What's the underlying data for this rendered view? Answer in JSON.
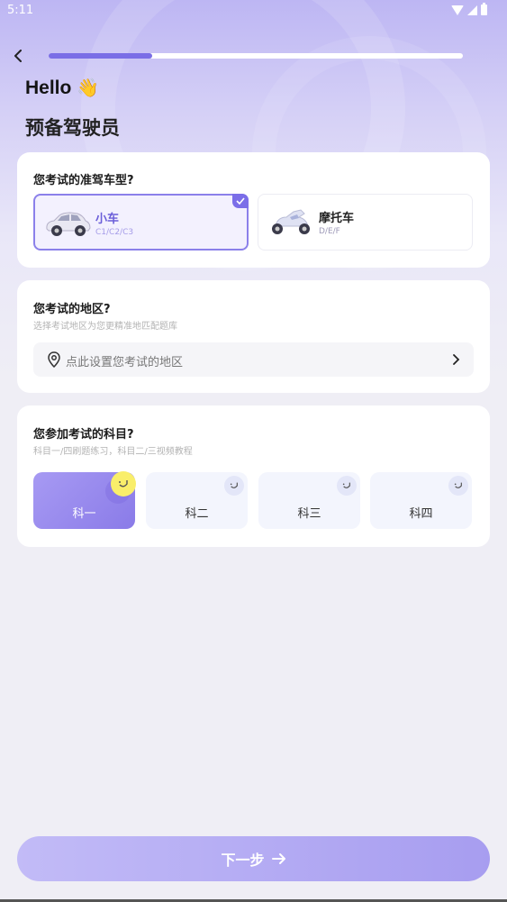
{
  "status": {
    "time": "5:11"
  },
  "header": {
    "progress": 0.25,
    "greeting": "Hello",
    "emoji": "👋",
    "subtitle": "预备驾驶员"
  },
  "vehicle": {
    "title": "您考试的准驾车型?",
    "options": [
      {
        "name": "小车",
        "sub": "C1/C2/C3",
        "selected": true
      },
      {
        "name": "摩托车",
        "sub": "D/E/F",
        "selected": false
      }
    ]
  },
  "region": {
    "title": "您考试的地区?",
    "desc": "选择考试地区为您更精准地匹配题库",
    "placeholder": "点此设置您考试的地区"
  },
  "subjects": {
    "title": "您参加考试的科目?",
    "desc": "科目一/四刷题练习，科目二/三视频教程",
    "items": [
      {
        "label": "科一",
        "active": true
      },
      {
        "label": "科二",
        "active": false
      },
      {
        "label": "科三",
        "active": false
      },
      {
        "label": "科四",
        "active": false
      }
    ]
  },
  "footer": {
    "next_label": "下一步"
  },
  "colors": {
    "accent": "#7b6ee8",
    "selected_bg": "#f3f1fe",
    "button": "#b3aaf3"
  }
}
